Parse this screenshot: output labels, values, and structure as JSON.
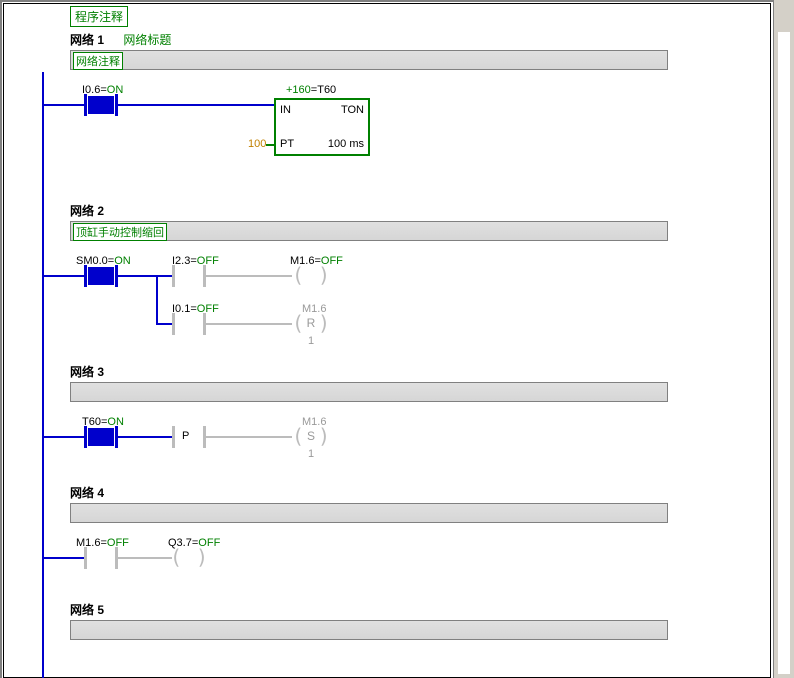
{
  "program_comment": "程序注释",
  "networks": {
    "n1": {
      "header": "网络 1",
      "title": "网络标题",
      "comment": "网络注释",
      "contact1": {
        "name": "I0.6",
        "state": "ON"
      },
      "timer": {
        "topval": "+160",
        "topname": "T60",
        "in": "IN",
        "type": "TON",
        "ptval": "100",
        "pt": "PT",
        "ptunit": "100 ms"
      }
    },
    "n2": {
      "header": "网络 2",
      "comment": "顶缸手动控制缩回",
      "c1": {
        "name": "SM0.0",
        "state": "ON"
      },
      "c2": {
        "name": "I2.3",
        "state": "OFF"
      },
      "c3": {
        "name": "M1.6",
        "state": "OFF"
      },
      "c4": {
        "name": "I0.1",
        "state": "OFF"
      },
      "coil_r": {
        "name": "M1.6",
        "letter": "R",
        "below": "1"
      }
    },
    "n3": {
      "header": "网络 3",
      "c1": {
        "name": "T60",
        "state": "ON"
      },
      "p": "P",
      "coil_s": {
        "name": "M1.6",
        "letter": "S",
        "below": "1"
      }
    },
    "n4": {
      "header": "网络 4",
      "c1": {
        "name": "M1.6",
        "state": "OFF"
      },
      "c2": {
        "name": "Q3.7",
        "state": "OFF"
      }
    },
    "n5": {
      "header": "网络 5"
    }
  }
}
